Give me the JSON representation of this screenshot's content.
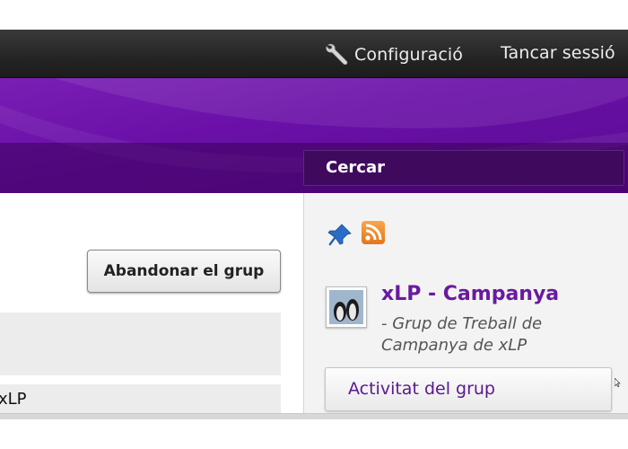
{
  "topbar": {
    "settings_label": "Configuració",
    "logout_label": "Tancar sessió",
    "settings_icon": "wrench-icon"
  },
  "banner": {
    "search_label": "Cercar"
  },
  "left": {
    "leave_button_label": "Abandonar el grup",
    "row_text": "xLP"
  },
  "sidebar": {
    "pin_icon": "pin-icon",
    "rss_icon": "rss-icon",
    "group_title": "xLP - Campanya",
    "group_description": "- Grup de Treball de Campanya de xLP",
    "activity_button_label": "Activitat del grup"
  },
  "colors": {
    "topbar": "#242424",
    "banner_purple": "#6a10a8",
    "link_purple": "#6a1aa0",
    "sidebar_bg": "#f3f3f3"
  }
}
